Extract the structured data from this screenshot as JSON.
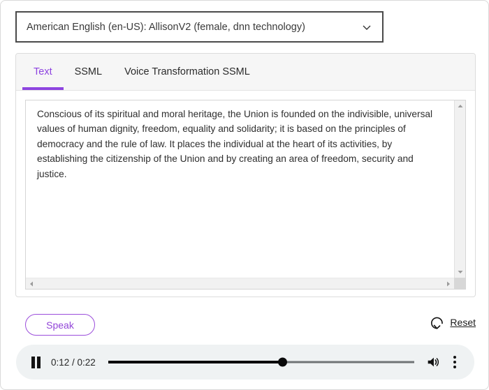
{
  "voice_select": {
    "value": "American English (en-US): AllisonV2 (female, dnn technology)",
    "icon": "chevron-down-icon"
  },
  "tabs": [
    {
      "label": "Text",
      "active": true
    },
    {
      "label": "SSML",
      "active": false
    },
    {
      "label": "Voice Transformation SSML",
      "active": false
    }
  ],
  "editor": {
    "value": "Conscious of its spiritual and moral heritage, the Union is founded on the indivisible, universal values of human dignity, freedom, equality and solidarity; it is based on the principles of democracy and the rule of law. It places the individual at the heart of its activities, by establishing the citizenship of the Union and by creating an area of freedom, security and justice.",
    "placeholder": "",
    "scroll_up_icon": "triangle-up-icon",
    "scroll_down_icon": "triangle-down-icon",
    "scroll_left_icon": "triangle-left-icon",
    "scroll_right_icon": "triangle-right-icon"
  },
  "actions": {
    "speak_label": "Speak",
    "reset_label": "Reset",
    "reset_icon": "rotate-ccw-icon"
  },
  "player": {
    "pause_icon": "pause-icon",
    "timecode": "0:12 / 0:22",
    "current_time": "0:12",
    "total_time": "0:22",
    "progress_percent": 57,
    "volume_icon": "volume-on-icon",
    "more_icon": "more-vertical-icon"
  },
  "colors": {
    "accent_purple": "#8e44e0",
    "player_bg": "#eff2f3",
    "tabbar_bg": "#f6f6f6",
    "text": "#2e2e2e"
  }
}
